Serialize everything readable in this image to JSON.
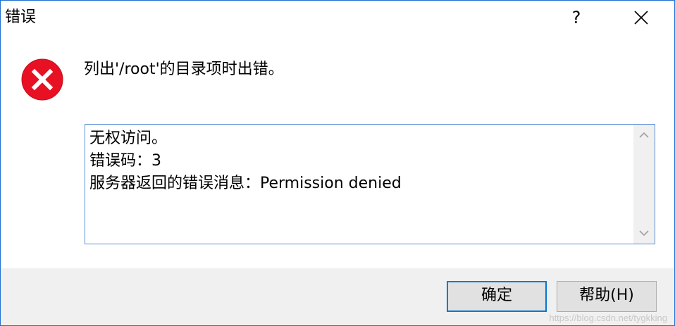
{
  "window": {
    "title": "错误",
    "help_label": "?",
    "close_icon": "close-icon"
  },
  "dialog": {
    "icon": "error-icon",
    "message": "列出'/root'的目录项时出错。",
    "details_text": "无权访问。\n错误码：3\n服务器返回的错误消息：Permission denied"
  },
  "buttons": {
    "ok_label": "确定",
    "help_label": "帮助(H)"
  },
  "watermark": "https://blog.csdn.net/tygkking",
  "colors": {
    "accent": "#0078d7",
    "error_red": "#e81123",
    "footer_bg": "#f0f0f0"
  }
}
